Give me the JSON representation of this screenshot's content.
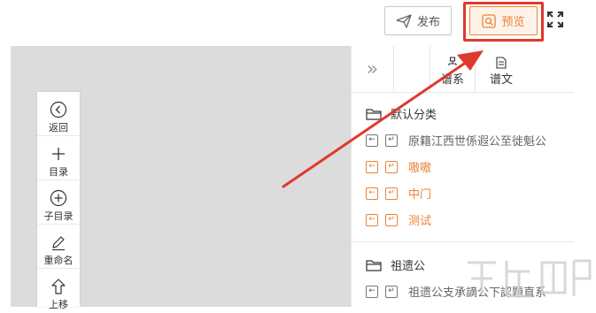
{
  "header": {
    "publish_label": "发布",
    "preview_label": "预览"
  },
  "toolbar": {
    "items": [
      {
        "label": "返回",
        "icon": "back-circle-icon"
      },
      {
        "label": "目录",
        "icon": "plus-icon"
      },
      {
        "label": "子目录",
        "icon": "plus-circle-icon"
      },
      {
        "label": "重命名",
        "icon": "pen-icon"
      },
      {
        "label": "上移",
        "icon": "arrow-up-icon"
      }
    ]
  },
  "panel": {
    "tabs": [
      {
        "label": "谱系",
        "icon": "tree-icon",
        "active": true
      },
      {
        "label": "谱文",
        "icon": "document-icon",
        "active": false
      }
    ],
    "groups": [
      {
        "title": "默认分类",
        "items": [
          {
            "label": "原籍江西世係遐公至徙魁公",
            "highlight": false
          },
          {
            "label": "嗷嗷",
            "highlight": true
          },
          {
            "label": "中门",
            "highlight": true
          },
          {
            "label": "测试",
            "highlight": true
          }
        ]
      },
      {
        "title": "祖遗公",
        "items": [
          {
            "label": "祖遗公支承謫公下認題直系",
            "highlight": false
          }
        ]
      }
    ]
  },
  "colors": {
    "accent": "#e8833a",
    "highlight_red": "#e0392c",
    "canvas": "#dcdcdc"
  }
}
